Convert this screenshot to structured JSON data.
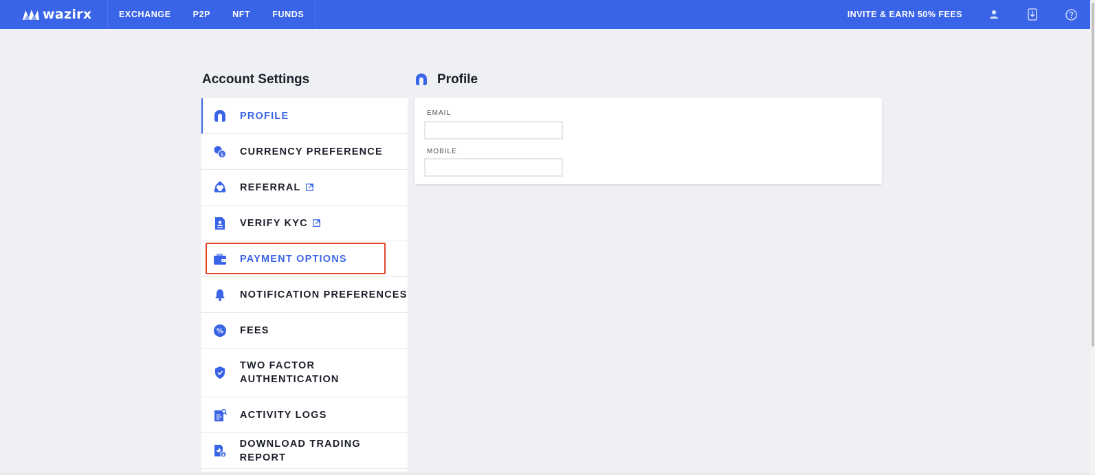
{
  "brand": {
    "name": "wazirx",
    "color": "#3a64e7"
  },
  "topnav": {
    "items": [
      "EXCHANGE",
      "P2P",
      "NFT",
      "FUNDS"
    ],
    "invite": "INVITE & EARN 50% FEES",
    "icons": [
      "user-icon",
      "download-icon",
      "help-icon"
    ]
  },
  "sidebar": {
    "title": "Account Settings",
    "items": [
      {
        "label": "PROFILE",
        "icon": "profile-icon"
      },
      {
        "label": "CURRENCY PREFERENCE",
        "icon": "currency-icon"
      },
      {
        "label": "REFERRAL",
        "icon": "referral-icon"
      },
      {
        "label": "VERIFY KYC",
        "icon": "kyc-document-icon"
      },
      {
        "label": "PAYMENT OPTIONS",
        "icon": "wallet-icon"
      },
      {
        "label": "NOTIFICATION PREFERENCES",
        "icon": "bell-icon"
      },
      {
        "label": "FEES",
        "icon": "percent-icon"
      },
      {
        "label": "TWO FACTOR AUTHENTICATION",
        "icon": "shield-icon"
      },
      {
        "label": "ACTIVITY LOGS",
        "icon": "activity-log-icon"
      },
      {
        "label": "DOWNLOAD TRADING REPORT",
        "icon": "report-download-icon"
      }
    ]
  },
  "main": {
    "title": "Profile",
    "fields": {
      "email": {
        "label": "EMAIL",
        "value": ""
      },
      "mobile": {
        "label": "MOBILE",
        "value": ""
      }
    }
  },
  "colors": {
    "accent": "#3a64e7",
    "highlight": "#e0442a",
    "background": "#eef0f3"
  }
}
